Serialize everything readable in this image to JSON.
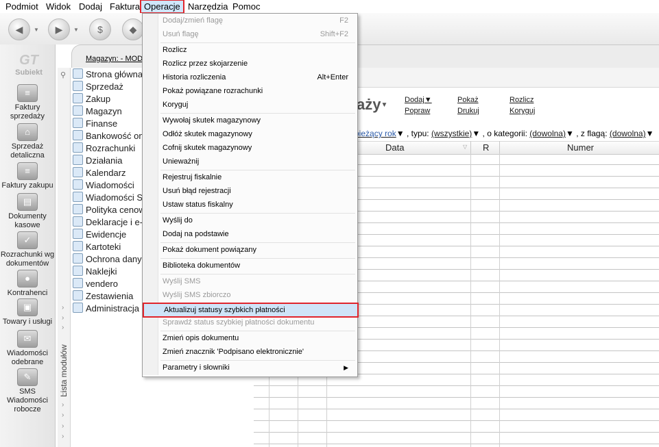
{
  "menubar": {
    "items": [
      "Podmiot",
      "Widok",
      "Dodaj",
      "Faktura",
      "Operacje",
      "Narzędzia",
      "Pomoc"
    ]
  },
  "logo": {
    "text": "Subiekt"
  },
  "leftnav": {
    "items": [
      {
        "label": "Faktury sprzedaży",
        "icon": "invoices-sales-icon"
      },
      {
        "label": "Sprzedaż detaliczna",
        "icon": "retail-sales-icon"
      },
      {
        "label": "Faktury zakupu",
        "icon": "purchase-invoices-icon"
      },
      {
        "label": "Dokumenty kasowe",
        "icon": "cash-documents-icon"
      },
      {
        "label": "Rozrachunki wg dokumentów",
        "icon": "settlements-icon"
      },
      {
        "label": "Kontrahenci",
        "icon": "contractors-icon"
      },
      {
        "label": "Towary i usługi",
        "icon": "goods-services-icon"
      },
      {
        "label": "Wiadomości odebrane",
        "icon": "messages-received-icon"
      },
      {
        "label": "SMS Wiadomości robocze",
        "icon": "sms-drafts-icon"
      }
    ]
  },
  "modules": {
    "vertical_label": "Lista modułów",
    "items": [
      "Strona główna",
      "Sprzedaż",
      "Zakup",
      "Magazyn",
      "Finanse",
      "Bankowość on-",
      "Rozrachunki",
      "Działania",
      "Kalendarz",
      "Wiadomości",
      "Wiadomości SM",
      "Polityka cenow",
      "Deklaracje i e-S",
      "Ewidencje",
      "Kartoteki",
      "Ochrona danyc",
      "Naklejki",
      "vendero",
      "Zestawienia",
      "Administracja"
    ]
  },
  "main": {
    "magazyn": "Magazyn: - MOD",
    "title": "aży",
    "actions": {
      "dodaj": "Dodaj",
      "pokaz": "Pokaż",
      "rozlicz": "Rozlicz",
      "popraw": "Popraw",
      "drukuj": "Drukuj",
      "koryguj": "Koryguj"
    },
    "filters": {
      "period": "bieżący rok",
      "type_label": ", typu:",
      "type_value": "(wszystkie)",
      "category_label": ", o kategorii:",
      "category_value": "(dowolna)",
      "flag_label": ", z flagą:",
      "flag_value": "(dowolna)"
    },
    "columns": [
      "Data",
      "R",
      "Numer"
    ]
  },
  "dropdown": {
    "items": [
      {
        "label": "Dodaj/zmień flagę",
        "shortcut": "F2",
        "disabled": true
      },
      {
        "label": "Usuń flagę",
        "shortcut": "Shift+F2",
        "disabled": true
      },
      {
        "label": "Rozlicz",
        "shortcut": "",
        "disabled": false
      },
      {
        "label": "Rozlicz przez skojarzenie",
        "shortcut": "",
        "disabled": false
      },
      {
        "label": "Historia rozliczenia",
        "shortcut": "Alt+Enter",
        "disabled": false
      },
      {
        "label": "Pokaż powiązane rozrachunki",
        "shortcut": "",
        "disabled": false
      },
      {
        "label": "Koryguj",
        "shortcut": "",
        "disabled": false
      },
      {
        "label": "Wywołaj skutek magazynowy",
        "shortcut": "",
        "disabled": false
      },
      {
        "label": "Odłóż skutek magazynowy",
        "shortcut": "",
        "disabled": false
      },
      {
        "label": "Cofnij skutek magazynowy",
        "shortcut": "",
        "disabled": false
      },
      {
        "label": "Unieważnij",
        "shortcut": "",
        "disabled": false
      },
      {
        "label": "Rejestruj fiskalnie",
        "shortcut": "",
        "disabled": false
      },
      {
        "label": "Usuń błąd rejestracji",
        "shortcut": "",
        "disabled": false
      },
      {
        "label": "Ustaw status fiskalny",
        "shortcut": "",
        "disabled": false
      },
      {
        "label": "Wyślij do",
        "shortcut": "",
        "disabled": false
      },
      {
        "label": "Dodaj na podstawie",
        "shortcut": "",
        "disabled": false
      },
      {
        "label": "Pokaż dokument powiązany",
        "shortcut": "",
        "disabled": false
      },
      {
        "label": "Biblioteka dokumentów",
        "shortcut": "",
        "disabled": false
      },
      {
        "label": "Wyślij SMS",
        "shortcut": "",
        "disabled": true
      },
      {
        "label": "Wyślij SMS zbiorczo",
        "shortcut": "",
        "disabled": true
      },
      {
        "label": "Aktualizuj statusy szybkich płatności",
        "shortcut": "",
        "disabled": false
      },
      {
        "label": "Sprawdź status szybkiej płatności dokumentu",
        "shortcut": "",
        "disabled": true
      },
      {
        "label": "Zmień opis dokumentu",
        "shortcut": "",
        "disabled": false
      },
      {
        "label": "Zmień znacznik 'Podpisano elektronicznie'",
        "shortcut": "",
        "disabled": false
      },
      {
        "label": "Parametry i słowniki",
        "shortcut": "",
        "disabled": false
      }
    ]
  },
  "colors": {
    "highlight_border": "#e0242b",
    "highlight_fill": "#cfe4f8"
  }
}
